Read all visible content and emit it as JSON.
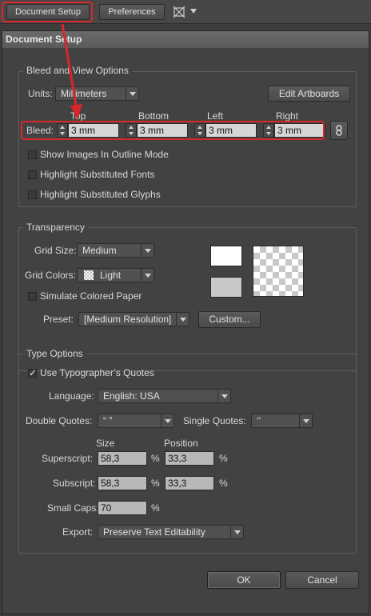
{
  "toolbar": {
    "document_setup_label": "Document Setup",
    "preferences_label": "Preferences"
  },
  "dialog": {
    "title": "Document Setup",
    "bleed_group": {
      "title": "Bleed and View Options",
      "units_label": "Units:",
      "units_value": "Millimeters",
      "edit_artboards_label": "Edit Artboards",
      "bleed_label": "Bleed:",
      "headers": {
        "top": "Top",
        "bottom": "Bottom",
        "left": "Left",
        "right": "Right"
      },
      "values": {
        "top": "3 mm",
        "bottom": "3 mm",
        "left": "3 mm",
        "right": "3 mm"
      },
      "show_images_outline": "Show Images In Outline Mode",
      "highlight_fonts": "Highlight Substituted Fonts",
      "highlight_glyphs": "Highlight Substituted Glyphs"
    },
    "transparency_group": {
      "title": "Transparency",
      "grid_size_label": "Grid Size:",
      "grid_size_value": "Medium",
      "grid_colors_label": "Grid Colors:",
      "grid_colors_value": "Light",
      "simulate_paper": "Simulate Colored Paper",
      "preset_label": "Preset:",
      "preset_value": "[Medium Resolution]",
      "custom_label": "Custom...",
      "colors": {
        "swatch_top": "#ffffff",
        "swatch_bottom": "#c8c8c8"
      }
    },
    "type_group": {
      "title": "Type Options",
      "use_quotes": "Use Typographer’s Quotes",
      "use_quotes_checked": true,
      "language_label": "Language:",
      "language_value": "English: USA",
      "double_quotes_label": "Double Quotes:",
      "double_quotes_value": "“ ”",
      "single_quotes_label": "Single Quotes:",
      "single_quotes_value": "‘’",
      "size_header": "Size",
      "position_header": "Position",
      "superscript_label": "Superscript:",
      "superscript_size": "58,3",
      "superscript_position": "33,3",
      "subscript_label": "Subscript:",
      "subscript_size": "58,3",
      "subscript_position": "33,3",
      "small_caps_label": "Small Caps:",
      "small_caps_value": "70",
      "percent": "%",
      "export_label": "Export:",
      "export_value": "Preserve Text Editability"
    },
    "ok_label": "OK",
    "cancel_label": "Cancel"
  },
  "annotation": {
    "color": "#d8262b"
  }
}
